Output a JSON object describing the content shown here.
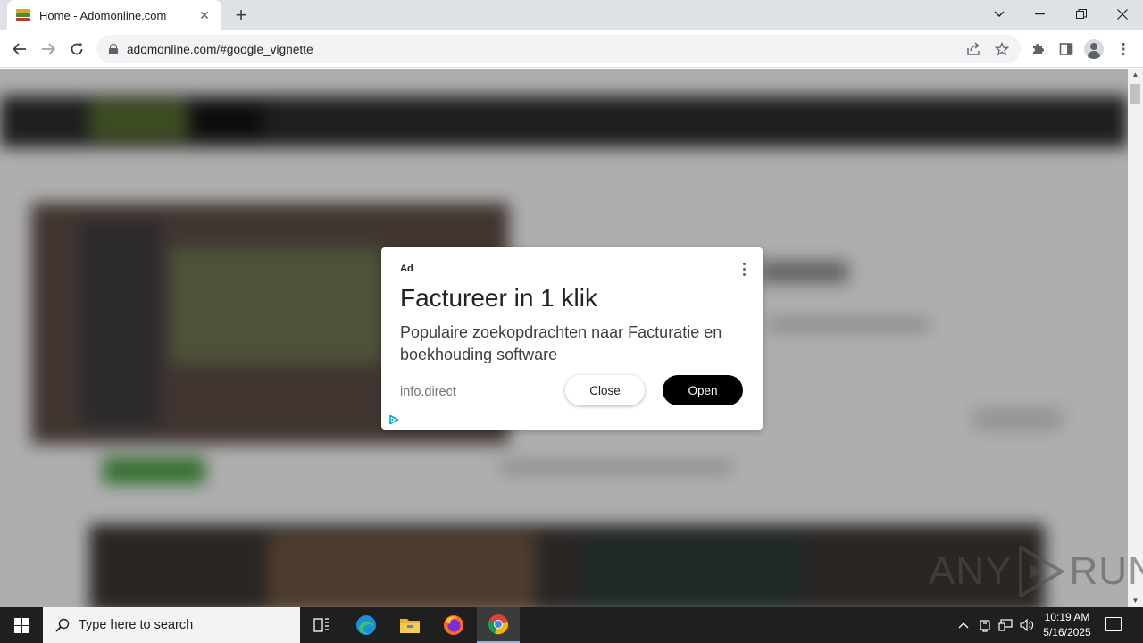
{
  "browser": {
    "tab": {
      "title": "Home - Adomonline.com",
      "favicon": "adomonline-favicon"
    },
    "new_tab_icon": "plus-icon",
    "window_controls": [
      "chevron-down-icon",
      "minimize-icon",
      "restore-icon",
      "close-icon"
    ],
    "url": "adomonline.com/#google_vignette",
    "toolbar_icons": [
      "share-icon",
      "star-icon",
      "extensions-icon",
      "side-panel-icon",
      "profile-icon",
      "more-icon"
    ]
  },
  "ad": {
    "label": "Ad",
    "title": "Factureer in 1 klik",
    "description": "Populaire zoekopdrachten naar Facturatie en boekhouding software",
    "domain": "info.direct",
    "close_label": "Close",
    "open_label": "Open",
    "accent_color": "#00aecd"
  },
  "watermark": {
    "left": "ANY",
    "right": "RUN"
  },
  "taskbar": {
    "search_placeholder": "Type here to search",
    "apps": [
      "task-view-icon",
      "edge-icon",
      "file-explorer-icon",
      "firefox-icon",
      "chrome-icon"
    ],
    "active_app": "chrome-icon",
    "time": "10:19 AM",
    "date": "5/16/2025"
  }
}
